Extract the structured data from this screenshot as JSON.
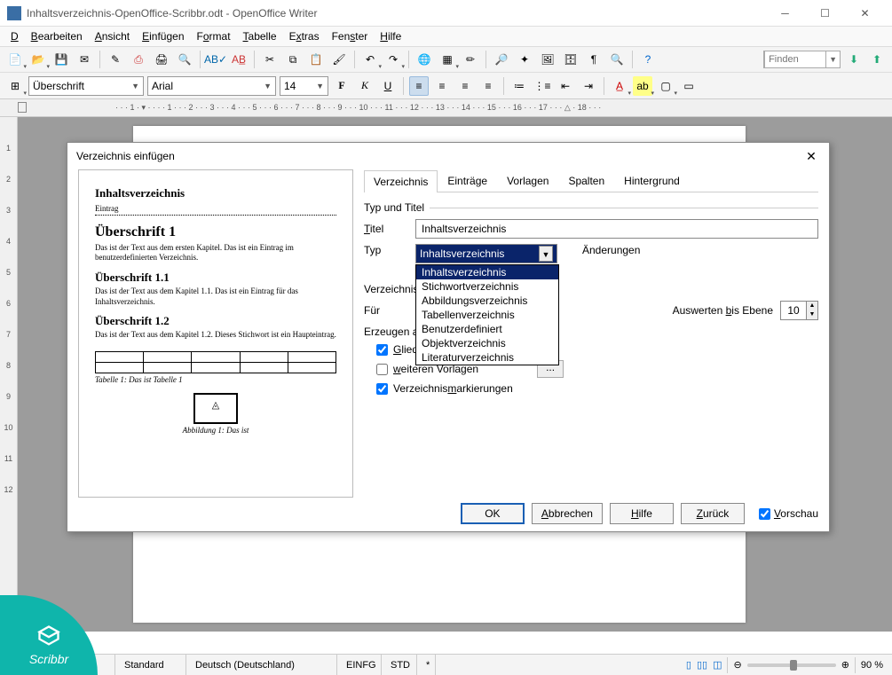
{
  "window": {
    "title": "Inhaltsverzeichnis-OpenOffice-Scribbr.odt - OpenOffice Writer"
  },
  "menu": [
    "Datei",
    "Bearbeiten",
    "Ansicht",
    "Einfügen",
    "Format",
    "Tabelle",
    "Extras",
    "Fenster",
    "Hilfe"
  ],
  "find": {
    "placeholder": "Finden"
  },
  "format": {
    "style": "Überschrift",
    "font": "Arial",
    "size": "14"
  },
  "status": {
    "page": "",
    "style": "Standard",
    "lang": "Deutsch (Deutschland)",
    "ins": "EINFG",
    "std": "STD",
    "mod": "*",
    "zoom": "90 %"
  },
  "dialog": {
    "title": "Verzeichnis einfügen",
    "tabs": [
      "Verzeichnis",
      "Einträge",
      "Vorlagen",
      "Spalten",
      "Hintergrund"
    ],
    "section_type_title": "Typ und Titel",
    "label_title": "Titel",
    "value_title": "Inhaltsverzeichnis",
    "label_typ": "Typ",
    "typ_selected": "Inhaltsverzeichnis",
    "typ_options": [
      "Inhaltsverzeichnis",
      "Stichwortverzeichnis",
      "Abbildungsverzeichnis",
      "Tabellenverzeichnis",
      "Benutzerdefiniert",
      "Objektverzeichnis",
      "Literaturverzeichnis"
    ],
    "protect_changes": "Änderungen",
    "section_create": "Verzeichnis erst",
    "label_for": "Für",
    "label_eval_level": "Auswerten bis Ebene",
    "eval_level_value": "10",
    "section_from": "Erzeugen aus",
    "cb_outline": "Gliederung",
    "cb_templates": "weiteren Vorlagen",
    "cb_marks": "Verzeichnismarkierungen",
    "dotsbtn": "...",
    "buttons": {
      "ok": "OK",
      "cancel": "Abbrechen",
      "help": "Hilfe",
      "back": "Zurück"
    },
    "preview_cb": "Vorschau"
  },
  "preview": {
    "title": "Inhaltsverzeichnis",
    "entry": "Eintrag",
    "h1": "Überschrift 1",
    "b1": "Das ist der Text aus dem ersten Kapitel. Das ist ein Eintrag im benutzerdefinierten Verzeichnis.",
    "h11": "Überschrift 1.1",
    "b11": "Das ist der Text aus dem Kapitel 1.1. Das ist ein Eintrag für das Inhaltsverzeichnis.",
    "h12": "Überschrift 1.2",
    "b12": "Das ist der Text aus dem Kapitel 1.2. Dieses Stichwort ist ein Haupteintrag.",
    "tcap": "Tabelle 1: Das ist Tabelle 1",
    "icap": "Abbildung 1: Das ist"
  },
  "scribbr": "Scribbr"
}
